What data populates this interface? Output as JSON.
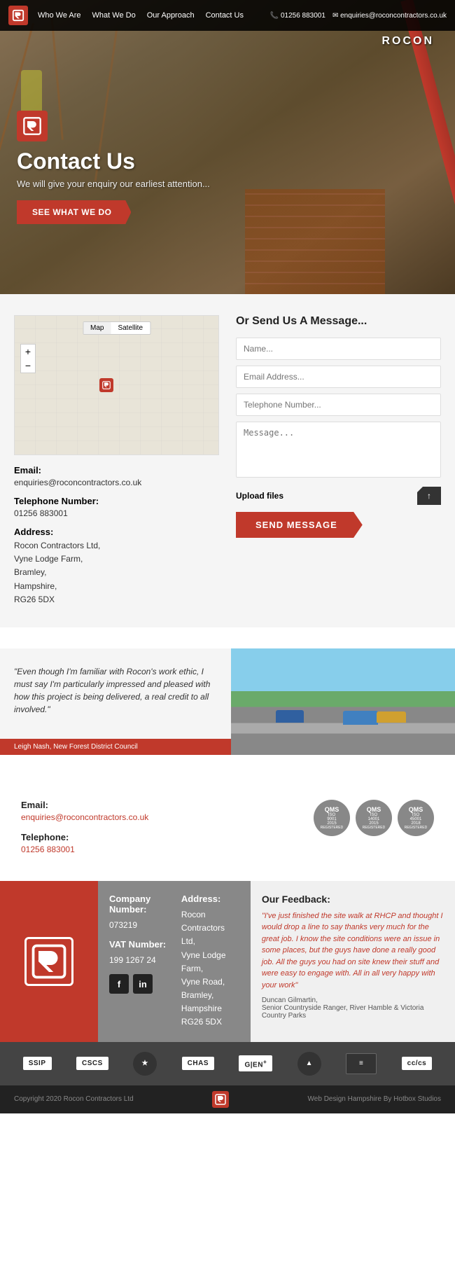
{
  "nav": {
    "links": [
      "Who We Are",
      "What We Do",
      "Our Approach",
      "Contact Us"
    ],
    "phone": "01256 883001",
    "email": "enquiries@roconcontractors.co.uk"
  },
  "hero": {
    "title": "Contact Us",
    "subtitle": "We will give your enquiry our earliest attention...",
    "cta_button": "SEE WHAT WE DO",
    "crane_brand": "ROCON"
  },
  "contact": {
    "section_title": "Or Send Us A Message...",
    "map_tab1": "Map",
    "map_tab2": "Satellite",
    "email_label": "Email:",
    "email_value": "enquiries@roconcontractors.co.uk",
    "phone_label": "Telephone Number:",
    "phone_value": "01256 883001",
    "address_label": "Address:",
    "address_lines": [
      "Rocon Contractors Ltd,",
      "Vyne Lodge Farm,",
      "Bramley,",
      "Hampshire,",
      "RG26 5DX"
    ],
    "form": {
      "name_placeholder": "Name...",
      "email_placeholder": "Email Address...",
      "phone_placeholder": "Telephone Number...",
      "message_placeholder": "Message...",
      "upload_label": "Upload files",
      "upload_btn": "↑",
      "send_btn": "SEND MESSAGE"
    }
  },
  "testimonial": {
    "quote": "\"Even though I'm familiar with Rocon's work ethic, I must say I'm particularly impressed and pleased with how this project is being delivered, a real credit to all involved.\"",
    "author": "Leigh Nash, New Forest District Council"
  },
  "footer_top": {
    "email_label": "Email:",
    "email_value": "enquiries@roconcontractors.co.uk",
    "phone_label": "Telephone:",
    "phone_value": "01256 883001",
    "badges": [
      {
        "title": "QMS",
        "line1": "ISO",
        "line2": "9001",
        "line3": "2015",
        "line4": "REGISTERED",
        "line5": ""
      },
      {
        "title": "QMS",
        "line1": "ISO",
        "line2": "14001",
        "line3": "2015",
        "line4": "REGISTERED",
        "line5": ""
      },
      {
        "title": "QMS",
        "line1": "ISO",
        "line2": "45001",
        "line3": "2018",
        "line4": "REGISTERED",
        "line5": ""
      }
    ]
  },
  "footer_mid": {
    "company_title": "Company Number:",
    "company_number": "073219",
    "vat_title": "VAT Number:",
    "vat_number": "199 1267 24",
    "address_title": "Address:",
    "address_lines": [
      "Rocon Contractors Ltd,",
      "Vyne Lodge Farm,",
      "Vyne Road,",
      "Bramley,",
      "Hampshire",
      "RG26 5DX"
    ],
    "feedback_title": "Our Feedback:",
    "feedback_text": "\"I've just finished the site walk at RHCP and thought I would drop a line to say thanks very much for the great job. I know the site conditions were an issue in some places, but the guys have done a really good job. All the guys you had on site knew their stuff and were easy to engage with. All in all very happy with your work\"",
    "feedback_author": "Duncan Gilmartin,\nSenior Countryside Ranger, River Hamble & Victoria Country Parks"
  },
  "certifications": [
    "SSIP",
    "CSCS",
    "★",
    "CHAS",
    "G|EN+",
    "▲",
    "≡",
    "CC/CS"
  ],
  "bottom": {
    "copyright": "Copyright 2020 Rocon Contractors Ltd",
    "credit": "Web Design Hampshire By Hotbox Studios"
  }
}
